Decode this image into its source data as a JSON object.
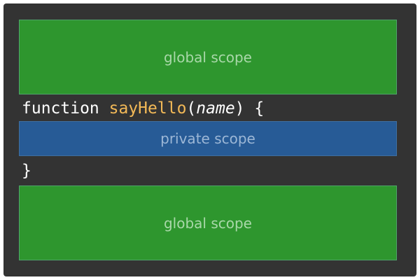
{
  "scopes": {
    "global_top_label": "global scope",
    "private_label": "private scope",
    "global_bottom_label": "global scope"
  },
  "code": {
    "keyword": "function",
    "function_name": "sayHello",
    "open_paren": "(",
    "parameter": "name",
    "close_paren_brace": ") {",
    "closing_brace": "}"
  },
  "colors": {
    "background": "#333333",
    "global_scope": "#2e962e",
    "private_scope": "#275b96",
    "function_name": "#f3b957"
  }
}
